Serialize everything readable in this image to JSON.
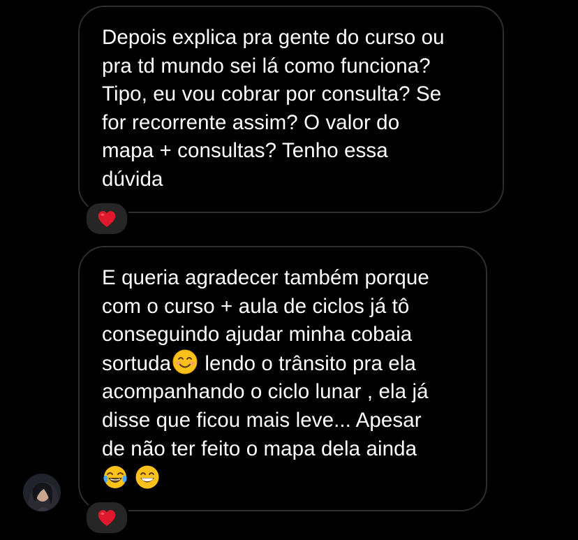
{
  "thread": {
    "messages": [
      {
        "text": "Depois explica pra gente do curso ou\npra td mundo sei lá como funciona?\nTipo, eu vou cobrar por consulta? Se\nfor recorrente assim? O valor do\nmapa + consultas? Tenho essa\ndúvida",
        "reaction": "❤️"
      },
      {
        "text_lines_before_emoji": "E queria agradecer também porque\ncom o curso + aula de ciclos já tô\nconseguindo ajudar minha cobaia\nsortuda",
        "inline_emoji": "smiling-face-icon",
        "text_after_emoji": " lendo o trânsito pra ela\nacompanhando o ciclo lunar , ela já\ndisse que ficou mais leve... Apesar\nde não ter feito o mapa dela ainda",
        "trailing_emojis": [
          "tears-of-joy-icon",
          "grinning-face-icon"
        ],
        "reaction": "❤️"
      }
    ]
  },
  "colors": {
    "background": "#000000",
    "bubble_border": "#2e2e2e",
    "text": "#ffffff",
    "reaction_pill": "#262626",
    "heart": "#e0182d"
  }
}
